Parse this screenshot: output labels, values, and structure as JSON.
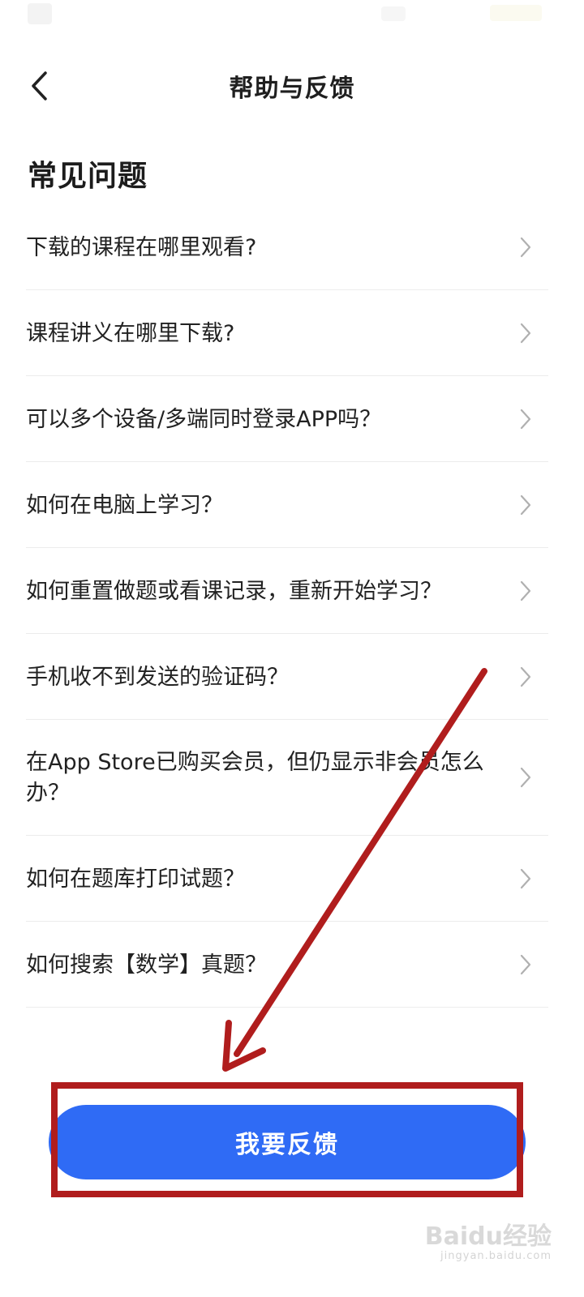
{
  "header": {
    "title": "帮助与反馈",
    "back_icon": "chevron-left-icon"
  },
  "section": {
    "title": "常见问题"
  },
  "faq": [
    {
      "question": "下载的课程在哪里观看?"
    },
    {
      "question": "课程讲义在哪里下载?"
    },
    {
      "question": "可以多个设备/多端同时登录APP吗？"
    },
    {
      "question": "如何在电脑上学习？"
    },
    {
      "question": "如何重置做题或看课记录，重新开始学习？"
    },
    {
      "question": "手机收不到发送的验证码？"
    },
    {
      "question": "在App Store已购买会员，但仍显示非会员怎么办？"
    },
    {
      "question": "如何在题库打印试题？"
    },
    {
      "question": "如何搜索【数学】真题？"
    }
  ],
  "feedback_button": {
    "label": "我要反馈"
  },
  "colors": {
    "primary_button": "#2f6bf5",
    "annotation": "#b01d1d"
  },
  "watermark": {
    "logo": "Baidu经验",
    "url": "jingyan.baidu.com"
  }
}
